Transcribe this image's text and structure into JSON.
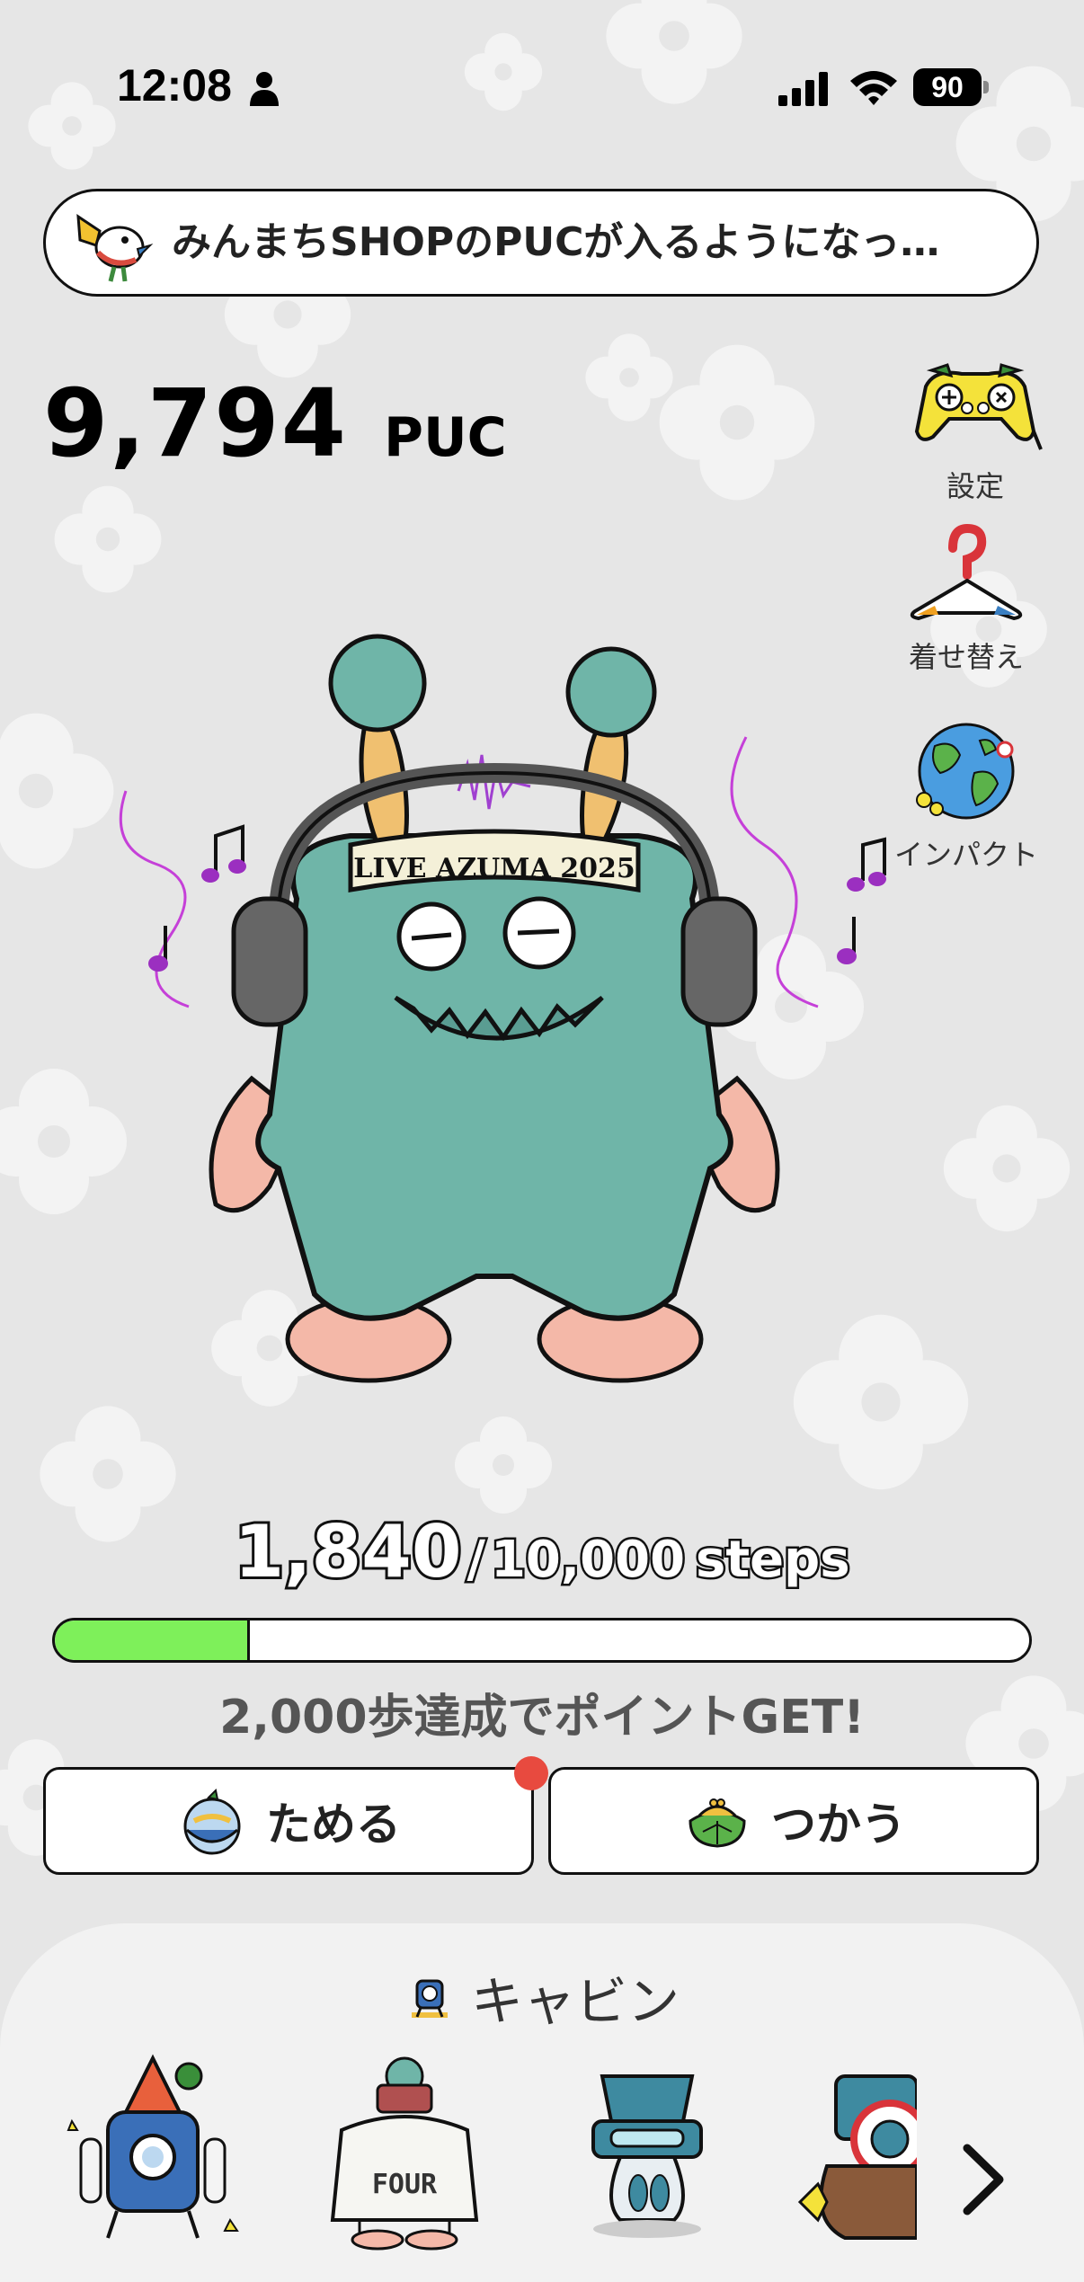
{
  "status_bar": {
    "time": "12:08",
    "battery": "90"
  },
  "notice": {
    "text": "みんまちSHOPのPUCが入るようになっ…",
    "icon": "megaphone-bird-icon"
  },
  "points": {
    "value": "9,794",
    "unit": "PUC"
  },
  "side_menu": {
    "settings_label": "設定",
    "dressup_label": "着せ替え",
    "impact_label": "インパクト"
  },
  "character": {
    "headband_text": "LIVE AZUMA 2025"
  },
  "steps": {
    "current": "1,840",
    "separator": "/",
    "goal": "10,000",
    "unit": "steps",
    "progress_fraction": 0.2,
    "hint": "2,000歩達成でポイントGET!"
  },
  "actions": {
    "save_label": "ためる",
    "use_label": "つかう"
  },
  "cabin": {
    "title": "キャビン"
  },
  "colors": {
    "background": "#e6e6e6",
    "progress": "#7ef05a",
    "badge": "#e84a3f",
    "monster": "#6fb5a8"
  }
}
